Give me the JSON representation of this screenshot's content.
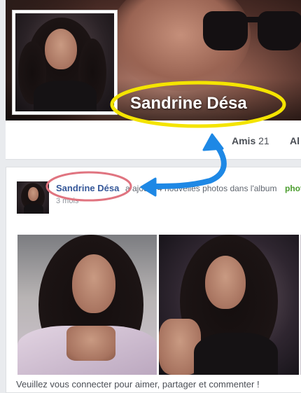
{
  "profile": {
    "name": "Sandrine Désa"
  },
  "tabs": {
    "friends_label": "Amis",
    "friends_count": "21",
    "albums_label_partial": "Al"
  },
  "post": {
    "author": "Sandrine Désa",
    "action_text": "a ajouté 4 nouvelles photos dans l'album",
    "album_partial": "phot",
    "time": "3 mois",
    "footer_text": "Veuillez vous connecter pour aimer, partager et commenter !"
  },
  "annotations": {
    "highlight_color": "#f4e400",
    "circle_color": "#e07480",
    "arrow_color": "#1e88e5"
  }
}
